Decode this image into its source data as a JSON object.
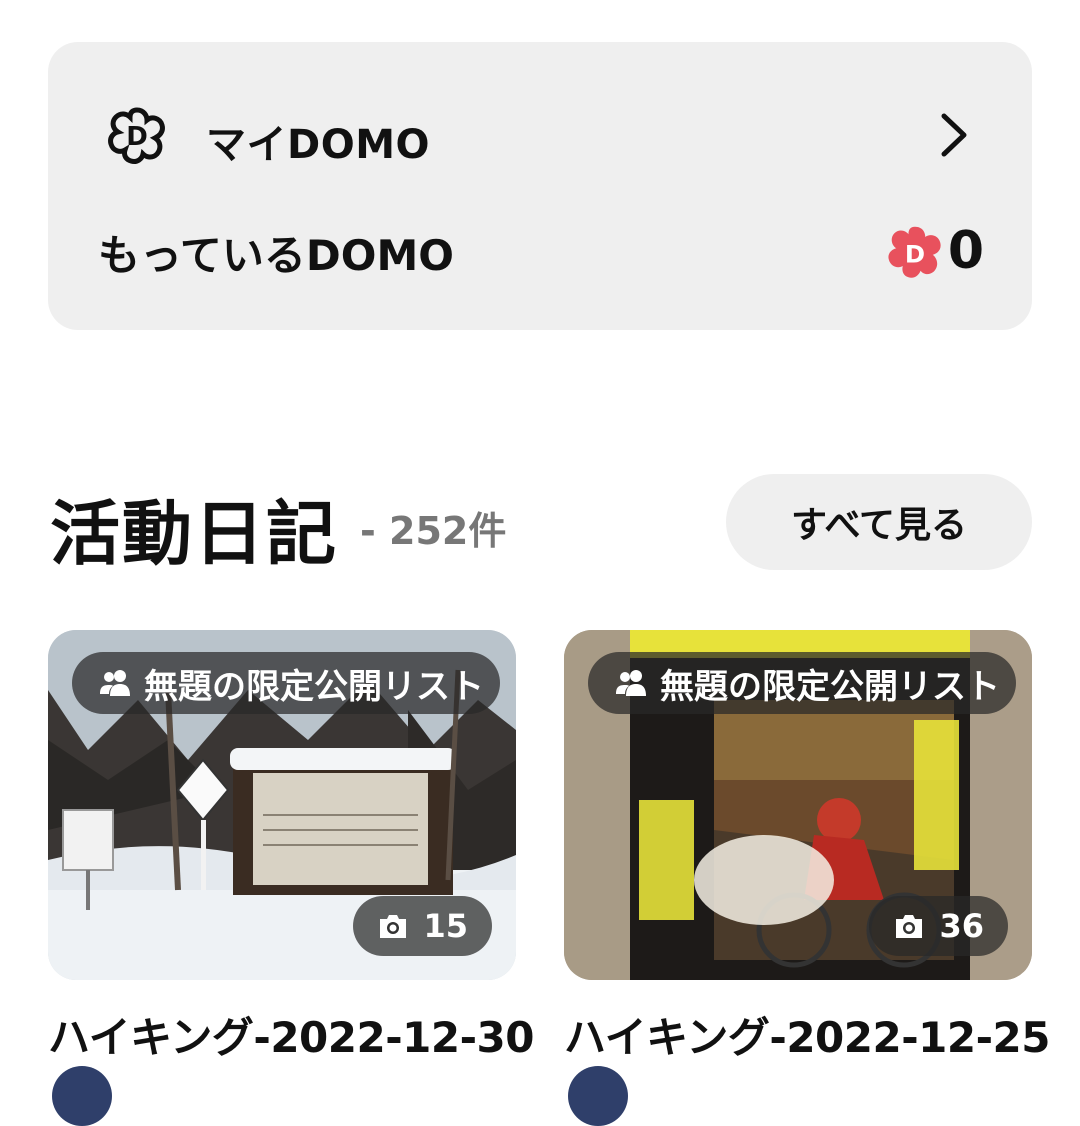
{
  "domo": {
    "mydomo_label": "マイDOMO",
    "owned_label": "もっているDOMO",
    "owned_count": "0"
  },
  "activity": {
    "title": "活動日記",
    "count": "- 252件",
    "see_all_label": "すべて見る",
    "cards": [
      {
        "badge": "無題の限定公開リスト",
        "photo_count": "15",
        "title": "ハイキング-2022-12-30"
      },
      {
        "badge": "無題の限定公開リスト",
        "photo_count": "36",
        "title": "ハイキング-2022-12-25"
      }
    ]
  },
  "colors": {
    "accent": "#e8515d",
    "card_bg": "#efefef"
  }
}
